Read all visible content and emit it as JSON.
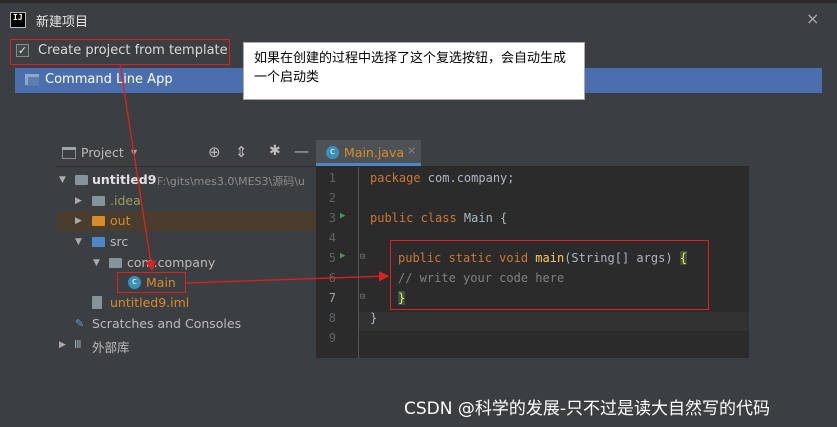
{
  "window": {
    "title": "新建项目",
    "close_icon": "×",
    "app_icon": "IJ"
  },
  "template_checkbox": {
    "label": "Create project from template",
    "checked": true
  },
  "template_list": {
    "selected_item": "Command Line App"
  },
  "annotation": {
    "text": "如果在创建的过程中选择了这个复选按钮，会自动生成一个启动类"
  },
  "project_panel": {
    "title": "Project",
    "tree": {
      "root": {
        "name": "untitled9",
        "path": "F:\\gits\\mes3.0\\MES3\\源码\\u"
      },
      "idea": ".idea",
      "out": "out",
      "src": "src",
      "package": "com.company",
      "main_class": "Main",
      "iml": "untitled9.iml",
      "scratches": "Scratches and Consoles",
      "external": "外部库"
    }
  },
  "editor": {
    "tab_label": "Main.java",
    "line_numbers": [
      "1",
      "2",
      "3",
      "4",
      "5",
      "6",
      "7",
      "8",
      "9"
    ],
    "lines": {
      "l1_kw": "package",
      "l1_rest": " com.company;",
      "l3_kw": "public class",
      "l3_rest": " Main {",
      "l5_kw": "public static void",
      "l5_fn": "main",
      "l5_rest": "(String[] args)",
      "l5_brace": "{",
      "l6": "// write your code here",
      "l7": "}",
      "l8": "}"
    }
  },
  "watermark": "CSDN @科学的发展-只不过是读大自然写的代码",
  "colors": {
    "accent": "#4b6eaf",
    "highlight_box": "#e02020"
  }
}
